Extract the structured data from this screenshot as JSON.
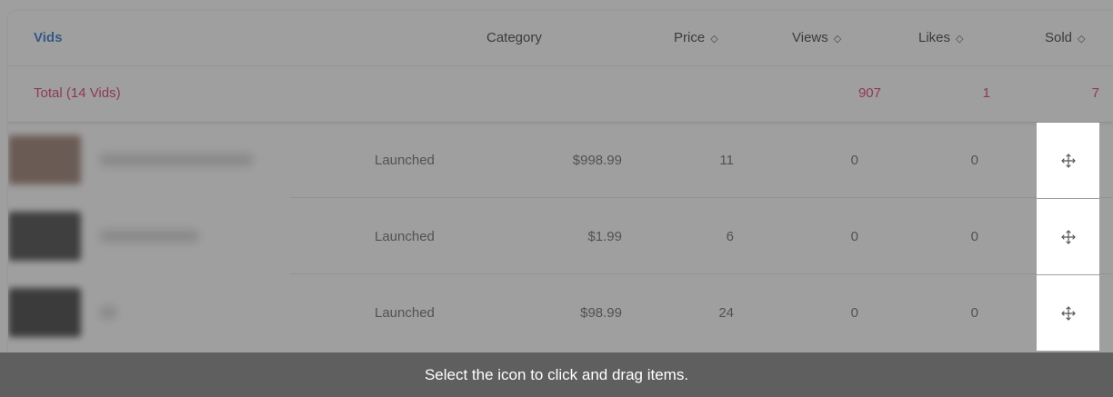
{
  "header": {
    "vids_label": "Vids",
    "category_label": "Category",
    "price_label": "Price",
    "views_label": "Views",
    "likes_label": "Likes",
    "sold_label": "Sold",
    "sort_glyph": "◇"
  },
  "total": {
    "label": "Total (14 Vids)",
    "views": "907",
    "likes": "1",
    "sold": "7"
  },
  "rows": [
    {
      "category": "Launched",
      "price": "$998.99",
      "views": "11",
      "likes": "0",
      "sold": "0",
      "thumb_color": "#8a6a5a"
    },
    {
      "category": "Launched",
      "price": "$1.99",
      "views": "6",
      "likes": "0",
      "sold": "0",
      "thumb_color": "#2a2a2a"
    },
    {
      "category": "Launched",
      "price": "$98.99",
      "views": "24",
      "likes": "0",
      "sold": "0",
      "thumb_color": "#222222"
    }
  ],
  "icons": {
    "drag": "move-icon",
    "sort": "sort-icon"
  },
  "banner": {
    "text": "Select the icon to click and drag items."
  },
  "colors": {
    "vids_link": "#1565c0",
    "total_accent": "#d81b60",
    "banner_bg": "#5f5f5f"
  }
}
